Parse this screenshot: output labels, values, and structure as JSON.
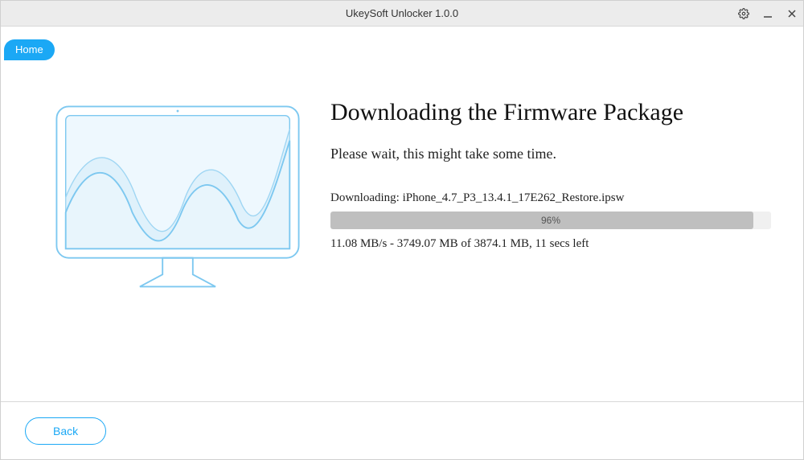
{
  "window": {
    "title": "UkeySoft Unlocker 1.0.0"
  },
  "nav": {
    "home_label": "Home"
  },
  "main": {
    "heading": "Downloading the Firmware Package",
    "subtext": "Please wait, this might take some time.",
    "download_prefix": "Downloading: ",
    "download_filename": "iPhone_4.7_P3_13.4.1_17E262_Restore.ipsw",
    "progress_percent": 96,
    "progress_label": "96%",
    "status_line": "11.08 MB/s - 3749.07 MB of 3874.1 MB, 11 secs left"
  },
  "footer": {
    "back_label": "Back"
  },
  "colors": {
    "accent": "#1ba8f5",
    "illustration_stroke": "#7dc8f0",
    "illustration_fill": "#dff1fb"
  }
}
